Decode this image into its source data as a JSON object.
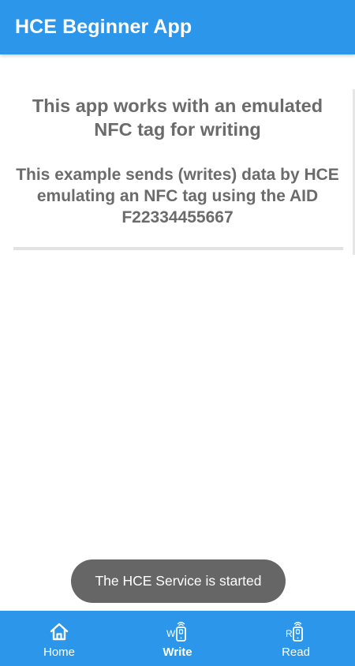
{
  "app_bar": {
    "title": "HCE Beginner App"
  },
  "main": {
    "headline": "This app works with an emulated NFC tag for writing",
    "description": "This example sends (writes) data by HCE emulating an NFC tag using the AID F22334455667"
  },
  "toast": {
    "message": "The HCE Service is started"
  },
  "bottom_nav": {
    "items": [
      {
        "label": "Home",
        "icon": "home-icon",
        "active": false
      },
      {
        "label": "Write",
        "icon": "nfc-write-icon",
        "active": true
      },
      {
        "label": "Read",
        "icon": "nfc-read-icon",
        "active": false
      }
    ]
  },
  "colors": {
    "primary": "#2b96ea",
    "text_gray": "#6b6b6b",
    "toast_bg": "#666666",
    "on_primary": "#ffffff"
  }
}
